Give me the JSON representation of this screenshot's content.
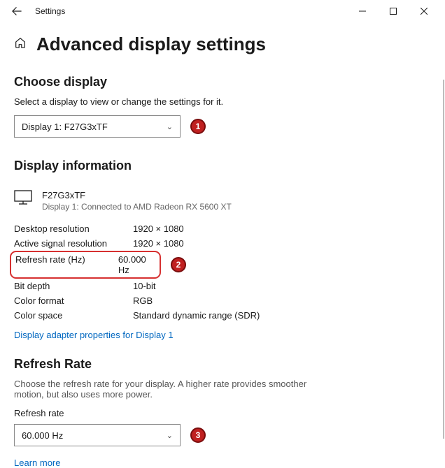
{
  "titlebar": {
    "title": "Settings"
  },
  "page": {
    "heading": "Advanced display settings"
  },
  "chooseDisplay": {
    "heading": "Choose display",
    "instruction": "Select a display to view or change the settings for it.",
    "dropdownValue": "Display 1: F27G3xTF"
  },
  "badges": {
    "b1": "1",
    "b2": "2",
    "b3": "3"
  },
  "displayInfo": {
    "heading": "Display information",
    "name": "F27G3xTF",
    "sub": "Display 1: Connected to AMD Radeon RX 5600 XT",
    "rows": [
      {
        "label": "Desktop resolution",
        "value": "1920 × 1080"
      },
      {
        "label": "Active signal resolution",
        "value": "1920 × 1080"
      },
      {
        "label": "Refresh rate (Hz)",
        "value": "60.000 Hz"
      },
      {
        "label": "Bit depth",
        "value": "10-bit"
      },
      {
        "label": "Color format",
        "value": "RGB"
      },
      {
        "label": "Color space",
        "value": "Standard dynamic range (SDR)"
      }
    ],
    "adapterLink": "Display adapter properties for Display 1"
  },
  "refreshRate": {
    "heading": "Refresh Rate",
    "desc": "Choose the refresh rate for your display. A higher rate provides smoother motion, but also uses more power.",
    "label": "Refresh rate",
    "dropdownValue": "60.000 Hz",
    "learnMore": "Learn more"
  }
}
